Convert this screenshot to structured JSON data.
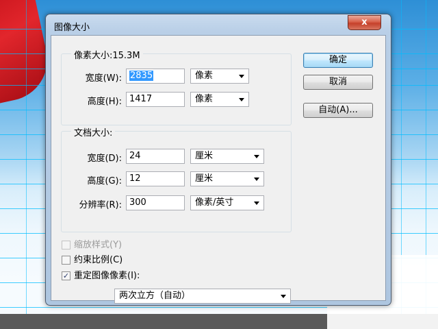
{
  "window": {
    "title": "图像大小",
    "close_glyph": "x"
  },
  "pixel_dimensions": {
    "title": "像素大小:15.3M",
    "width": {
      "label": "宽度(W):",
      "value": "2835",
      "unit": "像素"
    },
    "height": {
      "label": "高度(H):",
      "value": "1417",
      "unit": "像素"
    }
  },
  "document_size": {
    "title": "文档大小:",
    "width": {
      "label": "宽度(D):",
      "value": "24",
      "unit": "厘米"
    },
    "height": {
      "label": "高度(G):",
      "value": "12",
      "unit": "厘米"
    },
    "resolution": {
      "label": "分辨率(R):",
      "value": "300",
      "unit": "像素/英寸"
    }
  },
  "options": {
    "scale_styles": {
      "label": "缩放样式(Y)",
      "checked": false,
      "enabled": false
    },
    "constrain_proportions": {
      "label": "约束比例(C)",
      "checked": false,
      "enabled": true
    },
    "resample": {
      "label": "重定图像像素(I):",
      "checked": true,
      "enabled": true
    },
    "resample_method": "两次立方（自动）"
  },
  "buttons": {
    "ok": "确定",
    "cancel": "取消",
    "auto": "自动(A)..."
  },
  "check_glyph": "✓"
}
